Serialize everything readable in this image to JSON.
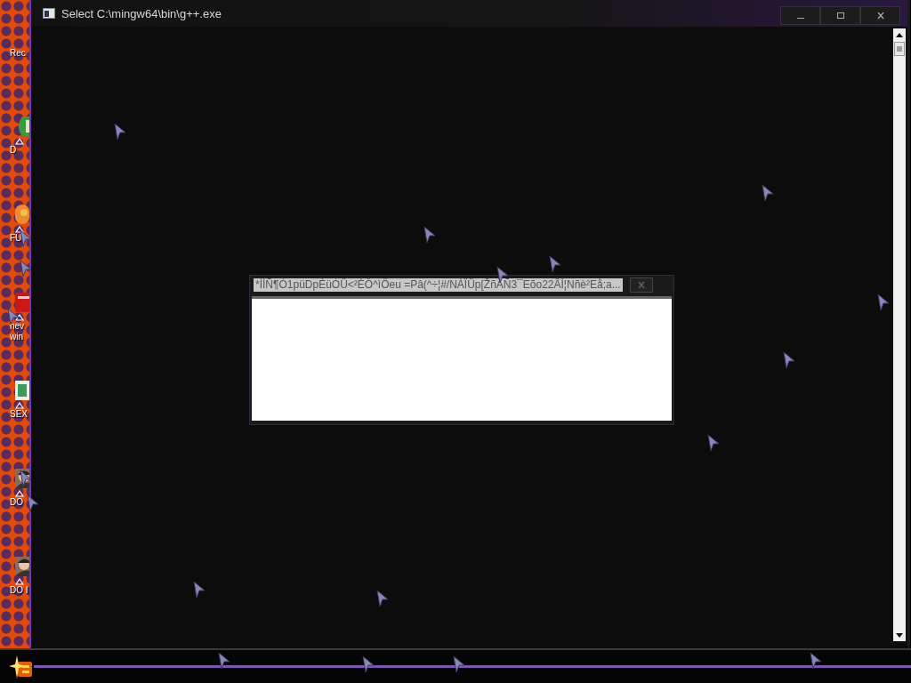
{
  "desktop": {
    "icons": [
      {
        "label": "Rec"
      },
      {
        "label": "D"
      },
      {
        "label": "FU"
      },
      {
        "label": "nev win"
      },
      {
        "label": "SEX"
      },
      {
        "label": "DO"
      },
      {
        "label": "DO I"
      }
    ]
  },
  "console_window": {
    "title": "Select C:\\mingw64\\bin\\g++.exe"
  },
  "dialog": {
    "title": "*ÌÍÑ¶Ò1püDpÈüÒÜ<²ÉÔ^ìÖeu =Pâ(^÷¦#/NÀÏÜp[ŽñÂÑ3¯Eõo22ÂÍ¦Nñè²Eå;a..."
  }
}
